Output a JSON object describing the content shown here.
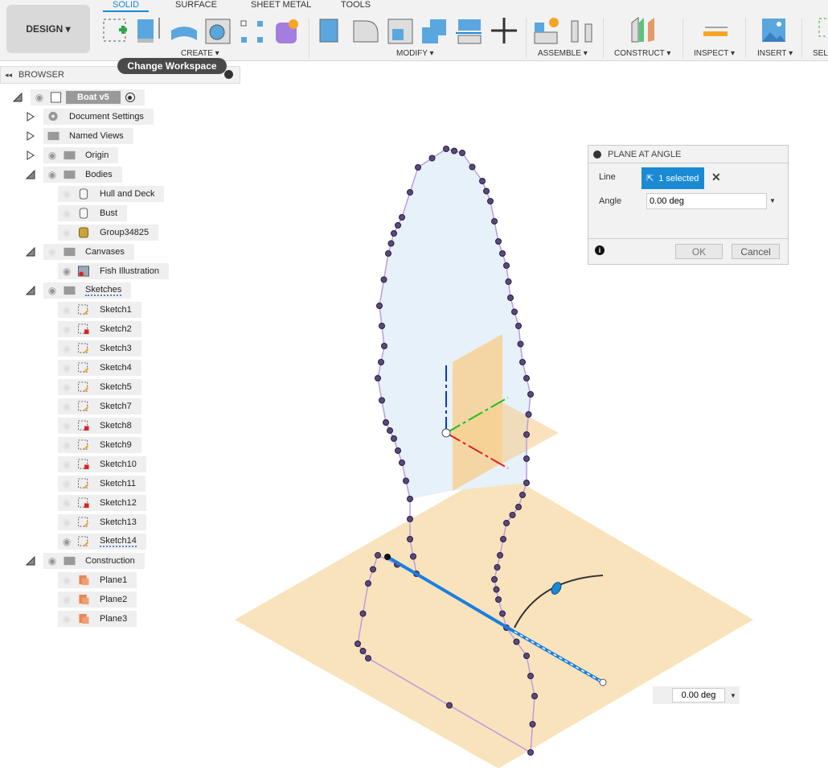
{
  "toolbar": {
    "workspace": "DESIGN",
    "tabs": [
      "SOLID",
      "SURFACE",
      "SHEET METAL",
      "TOOLS"
    ],
    "groups": [
      "CREATE",
      "MODIFY",
      "ASSEMBLE",
      "CONSTRUCT",
      "INSPECT",
      "INSERT",
      "SEL"
    ],
    "tooltip": "Change Workspace",
    "tools": [
      "create-sketch",
      "extrude",
      "revolve",
      "hole",
      "pattern",
      "create-form",
      "press-pull",
      "fillet",
      "shell",
      "combine",
      "offset-face",
      "move",
      "new-component",
      "joint",
      "plane-construct",
      "measure",
      "insert-image",
      "select"
    ]
  },
  "browser": {
    "title": "BROWSER",
    "items": [
      {
        "label": "Boat v5",
        "depth": 0,
        "expander": "open",
        "eye": "on",
        "icon": "component",
        "root": true
      },
      {
        "label": "Document Settings",
        "depth": 1,
        "expander": "closed",
        "eye": "none",
        "icon": "gear"
      },
      {
        "label": "Named Views",
        "depth": 1,
        "expander": "closed",
        "eye": "none",
        "icon": "folder"
      },
      {
        "label": "Origin",
        "depth": 1,
        "expander": "closed",
        "eye": "on",
        "icon": "folder"
      },
      {
        "label": "Bodies",
        "depth": 1,
        "expander": "open",
        "eye": "on",
        "icon": "folder"
      },
      {
        "label": "Hull and Deck",
        "depth": 2,
        "eye": "off",
        "icon": "body"
      },
      {
        "label": "Bust",
        "depth": 2,
        "eye": "off",
        "icon": "body"
      },
      {
        "label": "Group34825",
        "depth": 2,
        "eye": "off",
        "icon": "mesh"
      },
      {
        "label": "Canvases",
        "depth": 1,
        "expander": "open",
        "eye": "off",
        "icon": "folder"
      },
      {
        "label": "Fish Illustration",
        "depth": 2,
        "eye": "on",
        "icon": "canvas"
      },
      {
        "label": "Sketches",
        "depth": 1,
        "expander": "open",
        "eye": "on",
        "icon": "folder"
      },
      {
        "label": "Sketch1",
        "depth": 2,
        "eye": "off",
        "icon": "sketch"
      },
      {
        "label": "Sketch2",
        "depth": 2,
        "eye": "off",
        "icon": "sketch-error"
      },
      {
        "label": "Sketch3",
        "depth": 2,
        "eye": "off",
        "icon": "sketch"
      },
      {
        "label": "Sketch4",
        "depth": 2,
        "eye": "off",
        "icon": "sketch"
      },
      {
        "label": "Sketch5",
        "depth": 2,
        "eye": "off",
        "icon": "sketch"
      },
      {
        "label": "Sketch7",
        "depth": 2,
        "eye": "off",
        "icon": "sketch"
      },
      {
        "label": "Sketch8",
        "depth": 2,
        "eye": "off",
        "icon": "sketch-error"
      },
      {
        "label": "Sketch9",
        "depth": 2,
        "eye": "off",
        "icon": "sketch"
      },
      {
        "label": "Sketch10",
        "depth": 2,
        "eye": "off",
        "icon": "sketch-error"
      },
      {
        "label": "Sketch11",
        "depth": 2,
        "eye": "off",
        "icon": "sketch"
      },
      {
        "label": "Sketch12",
        "depth": 2,
        "eye": "off",
        "icon": "sketch-error"
      },
      {
        "label": "Sketch13",
        "depth": 2,
        "eye": "off",
        "icon": "sketch"
      },
      {
        "label": "Sketch14",
        "depth": 2,
        "eye": "on",
        "icon": "sketch"
      },
      {
        "label": "Construction",
        "depth": 1,
        "expander": "open",
        "eye": "on",
        "icon": "folder"
      },
      {
        "label": "Plane1",
        "depth": 2,
        "eye": "off",
        "icon": "plane"
      },
      {
        "label": "Plane2",
        "depth": 2,
        "eye": "off",
        "icon": "plane"
      },
      {
        "label": "Plane3",
        "depth": 2,
        "eye": "off",
        "icon": "plane"
      }
    ]
  },
  "dialog": {
    "title": "PLANE AT ANGLE",
    "line_label": "Line",
    "line_value": "1 selected",
    "angle_label": "Angle",
    "angle_value": "0.00 deg",
    "ok": "OK",
    "cancel": "Cancel"
  },
  "viewport": {
    "angle_input": "0.00 deg"
  },
  "colors": {
    "accent": "#1a8ad4",
    "plane": "#f8dcab",
    "sketch_fill": "#e6f1f9",
    "sketch_line": "#b79ee0",
    "points": "#5a4a78"
  }
}
